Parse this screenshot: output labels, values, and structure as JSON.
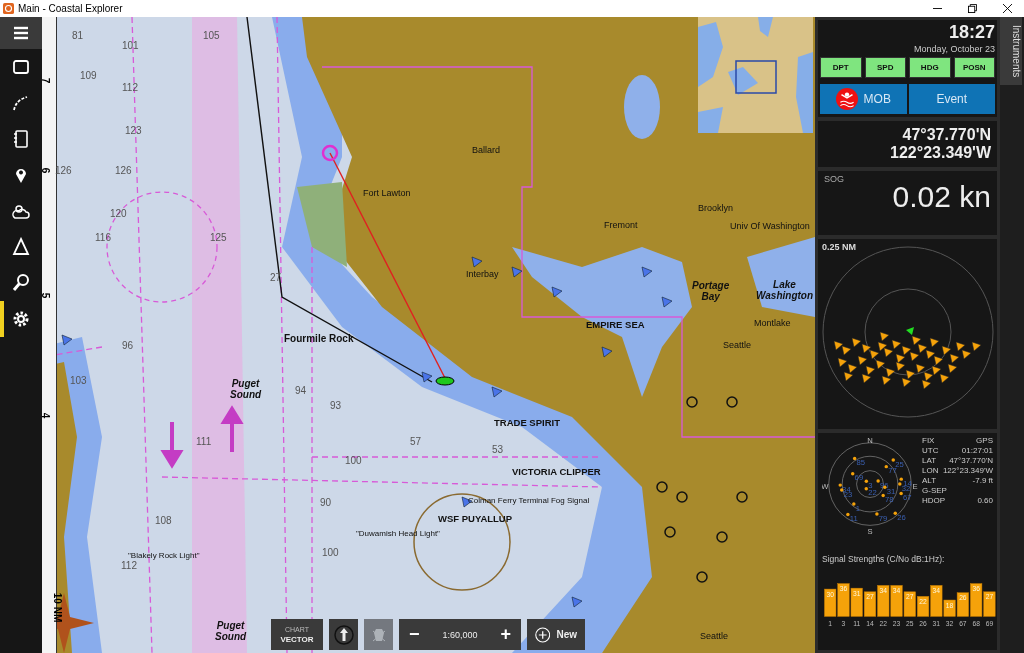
{
  "window": {
    "title": "Main - Coastal Explorer"
  },
  "toolbar": [
    {
      "kind": "menu",
      "selected": false
    },
    {
      "kind": "rectangle",
      "selected": false
    },
    {
      "kind": "route",
      "selected": false
    },
    {
      "kind": "notebook",
      "selected": false
    },
    {
      "kind": "pin",
      "selected": false
    },
    {
      "kind": "weather",
      "selected": false
    },
    {
      "kind": "triangle",
      "selected": false
    },
    {
      "kind": "search",
      "selected": false
    },
    {
      "kind": "settings",
      "selected": true
    }
  ],
  "chart": {
    "scale_marks": [
      "7",
      "6",
      "5",
      "4",
      "10 NM"
    ],
    "labels": [
      {
        "kind": "place",
        "text": "Ballard"
      },
      {
        "kind": "place",
        "text": "Fremont"
      },
      {
        "kind": "place",
        "text": "Brooklyn"
      },
      {
        "kind": "place",
        "text": "Univ Of Washington"
      },
      {
        "kind": "place",
        "text": "Interbay"
      },
      {
        "kind": "place",
        "text": "Fort Lawton"
      },
      {
        "kind": "area",
        "text": "Portage Bay"
      },
      {
        "kind": "area",
        "text": "Lake Washington"
      },
      {
        "kind": "place",
        "text": "Montlake"
      },
      {
        "kind": "place",
        "text": "Seattle"
      },
      {
        "kind": "feature",
        "text": "Fourmile Rock"
      },
      {
        "kind": "area",
        "text": "Puget Sound"
      },
      {
        "kind": "vessel",
        "text": "VICTORIA CLIPPER"
      },
      {
        "kind": "vessel",
        "text": "WSF PUYALLUP"
      },
      {
        "kind": "vessel",
        "text": "EMPIRE SEA"
      },
      {
        "kind": "light",
        "text": "Colman Ferry Terminal Fog Signal"
      },
      {
        "kind": "light",
        "text": "\"Duwamish Head Light\""
      },
      {
        "kind": "light",
        "text": "\"Blakely Rock Light\""
      },
      {
        "kind": "area",
        "text": "Puget Sound"
      },
      {
        "kind": "place",
        "text": "Seattle"
      },
      {
        "kind": "vessel",
        "text": "TRADE SPIRIT"
      }
    ],
    "soundings": [
      "81",
      "101",
      "105",
      "109",
      "112",
      "123",
      "126",
      "126",
      "125",
      "120",
      "116",
      "27",
      "111",
      "96",
      "94",
      "93",
      "100",
      "90",
      "57",
      "53",
      "103",
      "108",
      "100",
      "112"
    ],
    "controls": {
      "mode_label": "CHART",
      "mode_value": "VECTOR",
      "tracking_disabled": true,
      "zoom_out": "−",
      "scale": "1:60,000",
      "zoom_in": "+",
      "new_label": "New"
    }
  },
  "instruments": {
    "tab": "Instruments",
    "time": "18:27",
    "date": "Monday, October 23",
    "data_buttons": [
      "DPT",
      "SPD",
      "HDG",
      "POSN"
    ],
    "mob": "MOB",
    "event": "Event",
    "lat": "47°37.770'N",
    "lon": "122°23.349'W",
    "sog_label": "SOG",
    "sog": "0.02 kn",
    "ais_range": "0.25 NM",
    "compass": [
      "N",
      "E",
      "S",
      "W"
    ],
    "satellites": [
      "85",
      "25",
      "77",
      "69",
      "3",
      "96",
      "31",
      "14",
      "32",
      "67",
      "34",
      "23",
      "22",
      "78",
      "1",
      "11",
      "79",
      "26"
    ],
    "gps": [
      {
        "label": "FIX",
        "value": "GPS"
      },
      {
        "label": "UTC",
        "value": "01:27:01"
      },
      {
        "label": "LAT",
        "value": "47°37.770'N"
      },
      {
        "label": "LON",
        "value": "122°23.349'W"
      },
      {
        "label": "ALT",
        "value": "-7.9 ft"
      },
      {
        "label": "G-SEP"
      },
      {
        "label": "HDOP",
        "value": "0.60"
      }
    ],
    "signal_title": "Signal Strengths (C/No dB:1Hz):",
    "signal": {
      "chart_data": {
        "type": "bar",
        "categories": [
          "1",
          "3",
          "11",
          "14",
          "22",
          "23",
          "25",
          "26",
          "31",
          "32",
          "67",
          "68",
          "69"
        ],
        "values": [
          30,
          36,
          31,
          27,
          34,
          34,
          27,
          22,
          34,
          18,
          26,
          36,
          27
        ],
        "data_labels": true
      }
    }
  }
}
